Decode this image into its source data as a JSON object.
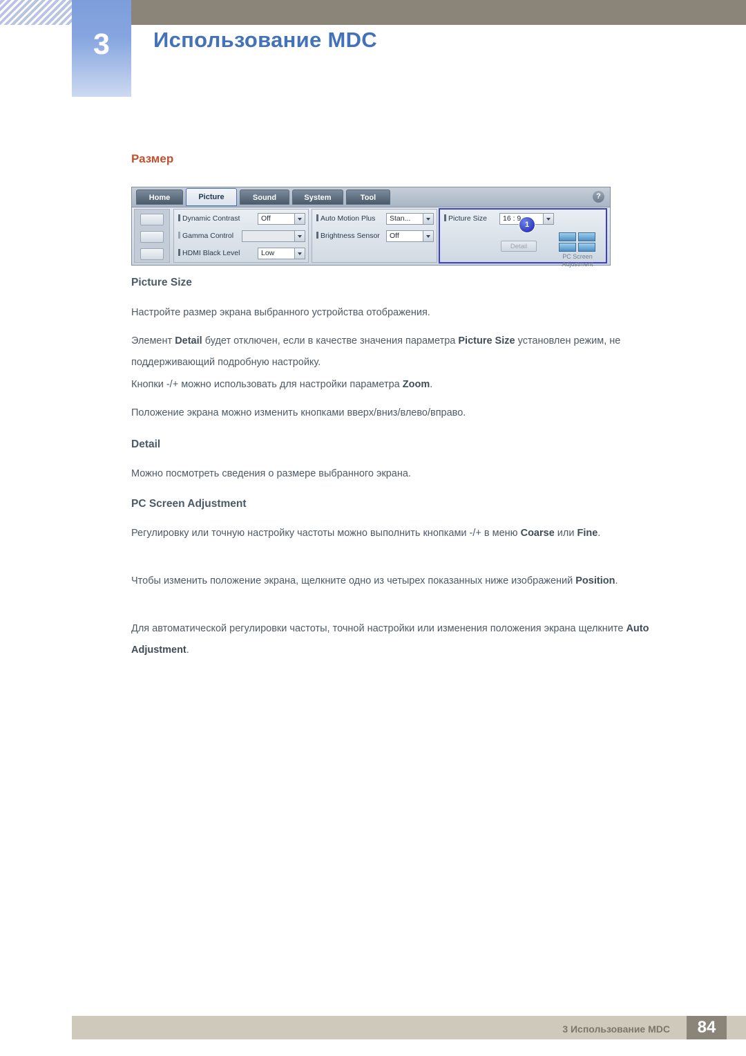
{
  "header": {
    "chapter_number": "3",
    "title": "Использование MDC"
  },
  "section": {
    "title": "Размер"
  },
  "mdc": {
    "tabs": [
      {
        "label": "Home",
        "active": false
      },
      {
        "label": "Picture",
        "active": true
      },
      {
        "label": "Sound",
        "active": false
      },
      {
        "label": "System",
        "active": false
      },
      {
        "label": "Tool",
        "active": false
      }
    ],
    "help_icon": "?",
    "left_rows": [
      {
        "label": "Dynamic Contrast",
        "value": "Off",
        "disabled": false
      },
      {
        "label": "Gamma Control",
        "value": "",
        "disabled": true
      },
      {
        "label": "HDMI Black Level",
        "value": "Low",
        "disabled": false
      }
    ],
    "mid_rows": [
      {
        "label": "Auto Motion Plus",
        "value": "Stan...",
        "disabled": false
      },
      {
        "label": "Brightness Sensor",
        "value": "Off",
        "disabled": false
      }
    ],
    "right_panel": {
      "label": "Picture Size",
      "value": "16 : 9",
      "detail_button": "Detail",
      "callout": "1",
      "pc_screen_label_line1": "PC Screen",
      "pc_screen_label_line2": "Adjustment"
    }
  },
  "content": {
    "picture_size_heading": "Picture Size",
    "picture_size_p1": "Настройте размер экрана выбранного устройства отображения.",
    "picture_size_p2_a": "Элемент ",
    "picture_size_p2_b": "Detail",
    "picture_size_p2_c": " будет отключен, если в качестве значения параметра ",
    "picture_size_p2_d": "Picture Size",
    "picture_size_p2_e": " установлен режим, не поддерживающий подробную настройку.",
    "picture_size_p3_a": "Кнопки -/+ можно использовать для настройки параметра ",
    "picture_size_p3_b": "Zoom",
    "picture_size_p3_c": ".",
    "picture_size_p4": "Положение экрана можно изменить кнопками вверх/вниз/влево/вправо.",
    "detail_heading": "Detail",
    "detail_p1": "Можно посмотреть сведения о размере выбранного экрана.",
    "pcsa_heading": "PC Screen Adjustment",
    "pcsa_p1_a": "Регулировку или точную настройку частоты можно выполнить кнопками -/+ в меню ",
    "pcsa_p1_b": "Coarse",
    "pcsa_p1_c": " или ",
    "pcsa_p1_d": "Fine",
    "pcsa_p1_e": ".",
    "pcsa_p2_a": "Чтобы изменить положение экрана, щелкните одно из четырех показанных ниже изображений ",
    "pcsa_p2_b": "Position",
    "pcsa_p2_c": ".",
    "pcsa_p3_a": "Для автоматической регулировки частоты, точной настройки или изменения положения экрана щелкните ",
    "pcsa_p3_b": "Auto Adjustment",
    "pcsa_p3_c": "."
  },
  "footer": {
    "text": "3 Использование MDC",
    "page": "84"
  }
}
